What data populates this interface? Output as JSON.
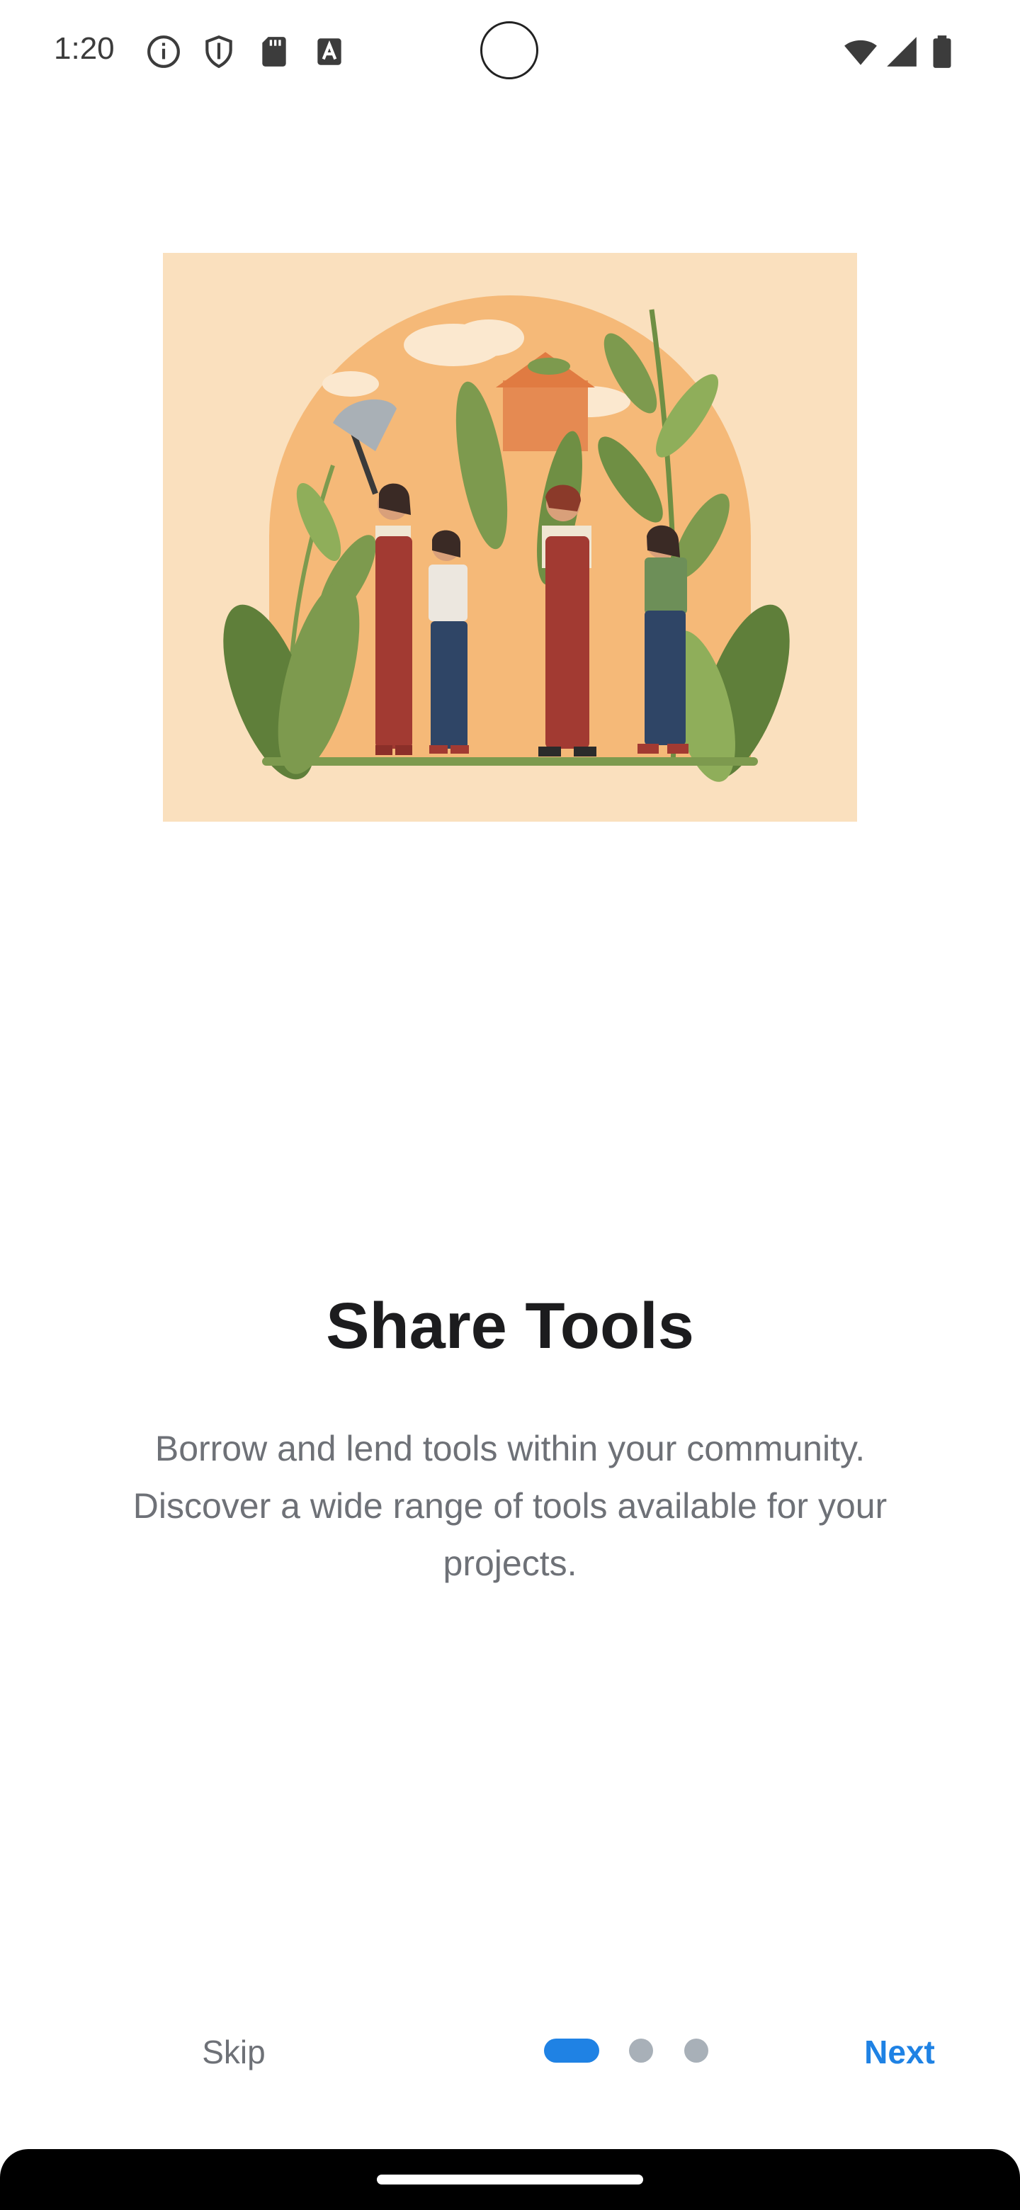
{
  "status_bar": {
    "time": "1:20",
    "left_icons": [
      "info-icon",
      "shield-icon",
      "sd-card-icon",
      "font-a-icon"
    ],
    "right_icons": [
      "wifi-icon",
      "signal-icon",
      "battery-icon"
    ]
  },
  "onboarding": {
    "illustration": "people-gardening-with-tools-illustration",
    "title": "Share Tools",
    "description_lines": [
      "Borrow and lend tools within your community.",
      "Discover a wide range of tools available for your",
      "projects."
    ],
    "page_indicator": {
      "current": 1,
      "total": 3
    }
  },
  "nav": {
    "skip_label": "Skip",
    "next_label": "Next"
  },
  "colors": {
    "accent": "#1f82e4",
    "muted_text": "#6e7177",
    "title_text": "#1c1c1e",
    "illustration_bg": "#fae0be",
    "inactive_dot": "#a8b0b8"
  }
}
